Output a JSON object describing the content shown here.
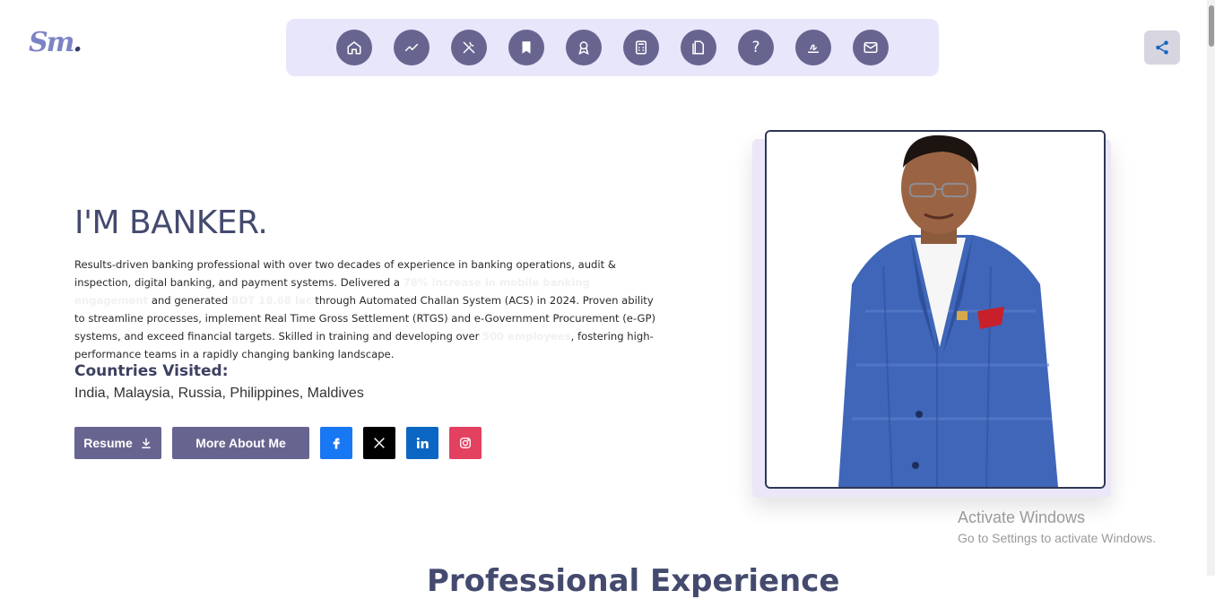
{
  "brand": {
    "logo_text": "Sm",
    "logo_dot": "."
  },
  "nav": {
    "icons": [
      "home-icon",
      "trend-icon",
      "tools-icon",
      "bookmark-icon",
      "award-icon",
      "calculator-icon",
      "documents-icon",
      "help-icon",
      "signature-icon",
      "mail-icon"
    ],
    "help_glyph": "?"
  },
  "hero": {
    "headline": "I'M BANKER.",
    "bio_parts": [
      "Results-driven banking professional with over two decades of experience in banking operations, audit & inspection, digital banking, and payment systems. Delivered a ",
      "78% increase in mobile banking engagement",
      " and generated ",
      "BDT 18.68 lac",
      " through Automated Challan System (ACS) in 2024. Proven ability to streamline processes, implement Real Time Gross Settlement (RTGS) and e-Government Procurement (e-GP) systems, and exceed financial targets. Skilled in training and developing over ",
      "500 employees",
      ", fostering high-performance teams in a rapidly changing banking landscape."
    ],
    "countries_title": "Countries Visited:",
    "countries_list": "India, Malaysia, Russia, Philippines, Maldives",
    "buttons": {
      "resume": "Resume",
      "about": "More About Me"
    },
    "socials": [
      "facebook",
      "x",
      "linkedin",
      "instagram"
    ]
  },
  "colors": {
    "accent": "#676590",
    "nav_bg": "#e8e6fa",
    "facebook": "#1877f2",
    "x": "#000000",
    "linkedin": "#0a66c2",
    "instagram": "#e4405f"
  },
  "watermark": {
    "line1": "Activate Windows",
    "line2": "Go to Settings to activate Windows."
  },
  "next_section": {
    "heading": "Professional Experience"
  }
}
